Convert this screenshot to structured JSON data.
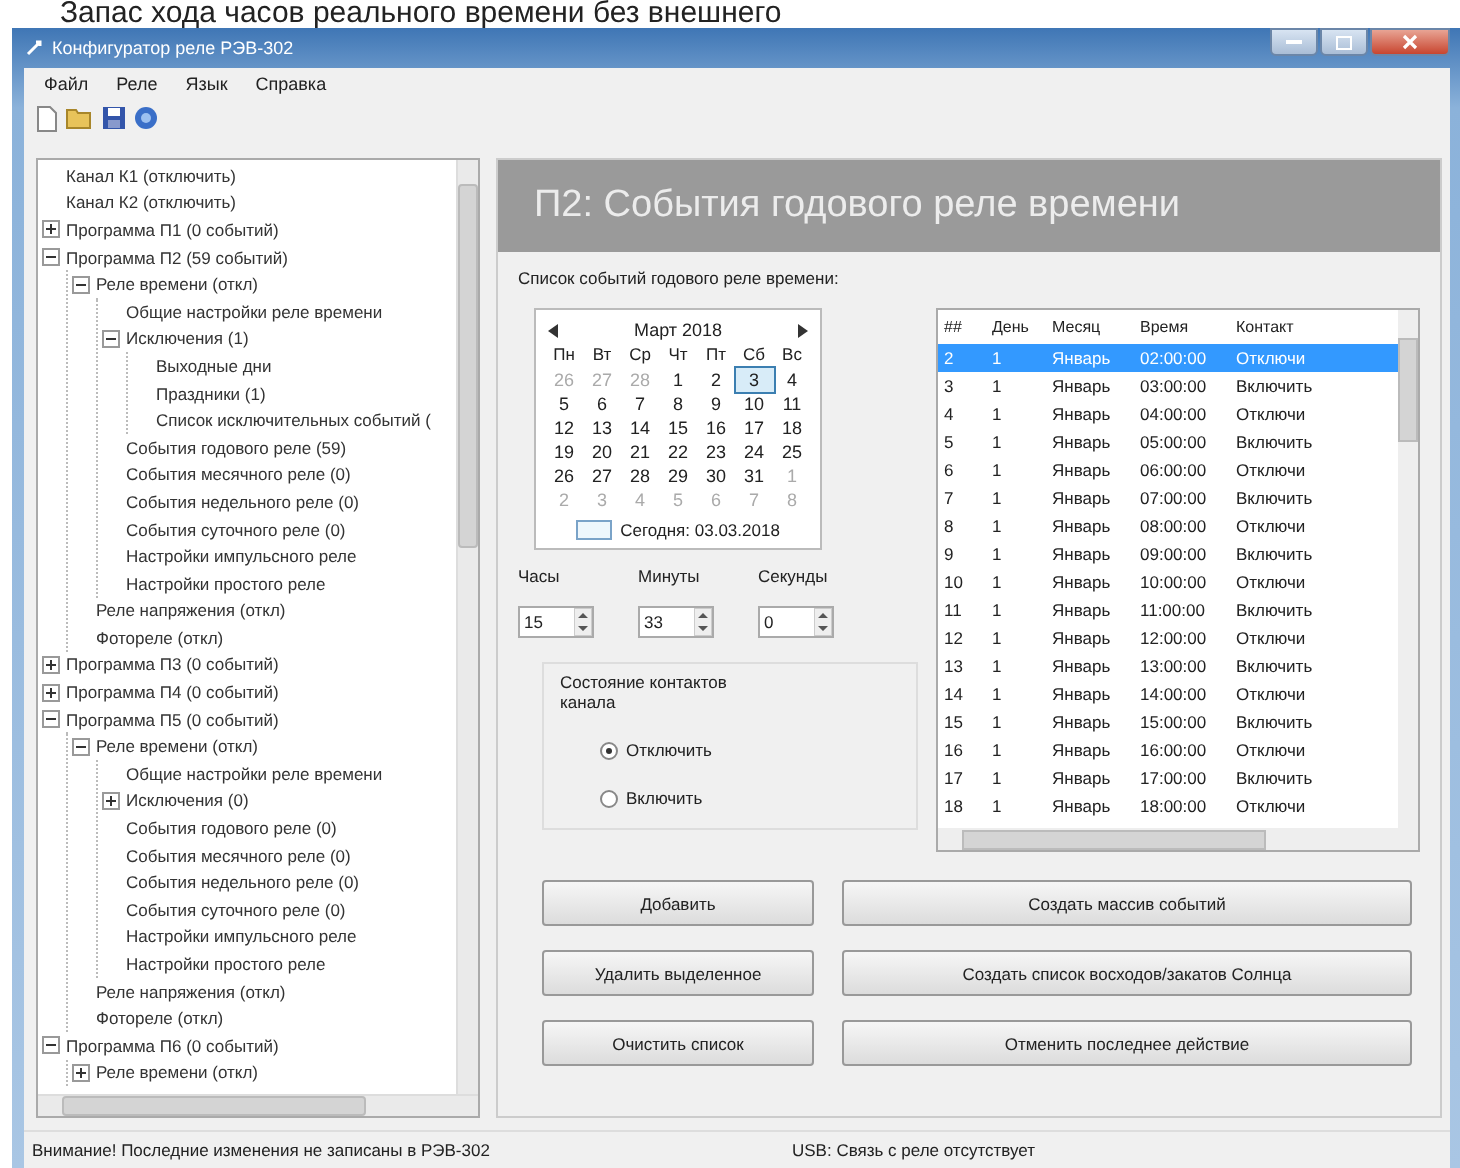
{
  "page_caption": "Запас хода часов реального времени без внешнего",
  "window": {
    "title": "Конфигуратор реле РЭВ-302"
  },
  "menu": [
    "Файл",
    "Реле",
    "Язык",
    "Справка"
  ],
  "tree": [
    {
      "label": "Канал К1 (отключить)"
    },
    {
      "label": "Канал К2 (отключить)"
    },
    {
      "label": "Программа П1 (0 событий)",
      "expanded": false
    },
    {
      "label": "Программа П2 (59 событий)",
      "expanded": true,
      "children": [
        {
          "label": "Реле времени (откл)",
          "expanded": true,
          "children": [
            {
              "label": "Общие настройки реле времени"
            },
            {
              "label": "Исключения (1)",
              "expanded": true,
              "children": [
                {
                  "label": "Выходные дни"
                },
                {
                  "label": "Праздники (1)"
                },
                {
                  "label": "Список исключительных событий ("
                }
              ]
            },
            {
              "label": "События годового реле (59)"
            },
            {
              "label": "События месячного реле (0)"
            },
            {
              "label": "События недельного реле (0)"
            },
            {
              "label": "События суточного реле (0)"
            },
            {
              "label": "Настройки импульсного реле"
            },
            {
              "label": "Настройки простого реле"
            }
          ]
        },
        {
          "label": "Реле напряжения (откл)"
        },
        {
          "label": "Фотореле (откл)"
        }
      ]
    },
    {
      "label": "Программа П3 (0 событий)",
      "expanded": false
    },
    {
      "label": "Программа П4 (0 событий)",
      "expanded": false
    },
    {
      "label": "Программа П5 (0 событий)",
      "expanded": true,
      "children": [
        {
          "label": "Реле времени (откл)",
          "expanded": true,
          "children": [
            {
              "label": "Общие настройки реле времени"
            },
            {
              "label": "Исключения (0)",
              "expanded": false
            },
            {
              "label": "События годового реле (0)"
            },
            {
              "label": "События месячного реле (0)"
            },
            {
              "label": "События недельного реле (0)"
            },
            {
              "label": "События суточного реле (0)"
            },
            {
              "label": "Настройки импульсного реле"
            },
            {
              "label": "Настройки простого реле"
            }
          ]
        },
        {
          "label": "Реле напряжения (откл)"
        },
        {
          "label": "Фотореле (откл)"
        }
      ]
    },
    {
      "label": "Программа П6 (0 событий)",
      "expanded": true,
      "children": [
        {
          "label": "Реле времени (откл)",
          "expanded": false
        }
      ]
    }
  ],
  "panel_title": "П2:  События годового реле времени",
  "list_label": "Список событий годового реле времени:",
  "calendar": {
    "month": "Март 2018",
    "weekdays": [
      "Пн",
      "Вт",
      "Ср",
      "Чт",
      "Пт",
      "Сб",
      "Вс"
    ],
    "weeks": [
      [
        {
          "day": "26",
          "muted": true,
          "selected": false
        },
        {
          "day": "27",
          "muted": true,
          "selected": false
        },
        {
          "day": "28",
          "muted": true,
          "selected": false
        },
        {
          "day": "1",
          "muted": false,
          "selected": false
        },
        {
          "day": "2",
          "muted": false,
          "selected": false
        },
        {
          "day": "3",
          "muted": false,
          "selected": true
        },
        {
          "day": "4",
          "muted": false,
          "selected": false
        }
      ],
      [
        {
          "day": "5",
          "muted": false,
          "selected": false
        },
        {
          "day": "6",
          "muted": false,
          "selected": false
        },
        {
          "day": "7",
          "muted": false,
          "selected": false
        },
        {
          "day": "8",
          "muted": false,
          "selected": false
        },
        {
          "day": "9",
          "muted": false,
          "selected": false
        },
        {
          "day": "10",
          "muted": false,
          "selected": false
        },
        {
          "day": "11",
          "muted": false,
          "selected": false
        }
      ],
      [
        {
          "day": "12",
          "muted": false,
          "selected": false
        },
        {
          "day": "13",
          "muted": false,
          "selected": false
        },
        {
          "day": "14",
          "muted": false,
          "selected": false
        },
        {
          "day": "15",
          "muted": false,
          "selected": false
        },
        {
          "day": "16",
          "muted": false,
          "selected": false
        },
        {
          "day": "17",
          "muted": false,
          "selected": false
        },
        {
          "day": "18",
          "muted": false,
          "selected": false
        }
      ],
      [
        {
          "day": "19",
          "muted": false,
          "selected": false
        },
        {
          "day": "20",
          "muted": false,
          "selected": false
        },
        {
          "day": "21",
          "muted": false,
          "selected": false
        },
        {
          "day": "22",
          "muted": false,
          "selected": false
        },
        {
          "day": "23",
          "muted": false,
          "selected": false
        },
        {
          "day": "24",
          "muted": false,
          "selected": false
        },
        {
          "day": "25",
          "muted": false,
          "selected": false
        }
      ],
      [
        {
          "day": "26",
          "muted": false,
          "selected": false
        },
        {
          "day": "27",
          "muted": false,
          "selected": false
        },
        {
          "day": "28",
          "muted": false,
          "selected": false
        },
        {
          "day": "29",
          "muted": false,
          "selected": false
        },
        {
          "day": "30",
          "muted": false,
          "selected": false
        },
        {
          "day": "31",
          "muted": false,
          "selected": false
        },
        {
          "day": "1",
          "muted": true,
          "selected": false
        }
      ],
      [
        {
          "day": "2",
          "muted": true,
          "selected": false
        },
        {
          "day": "3",
          "muted": true,
          "selected": false
        },
        {
          "day": "4",
          "muted": true,
          "selected": false
        },
        {
          "day": "5",
          "muted": true,
          "selected": false
        },
        {
          "day": "6",
          "muted": true,
          "selected": false
        },
        {
          "day": "7",
          "muted": true,
          "selected": false
        },
        {
          "day": "8",
          "muted": true,
          "selected": false
        }
      ]
    ],
    "today": "Сегодня: 03.03.2018"
  },
  "time_fields": [
    {
      "label": "Часы",
      "value": "15"
    },
    {
      "label": "Минуты",
      "value": "33"
    },
    {
      "label": "Секунды",
      "value": "0"
    }
  ],
  "contacts": {
    "title": "Состояние контактов канала",
    "options": [
      {
        "label": "Отключить",
        "selected": true
      },
      {
        "label": "Включить",
        "selected": false
      }
    ]
  },
  "table": {
    "columns": [
      "##",
      "День",
      "Месяц",
      "Время",
      "Контакт"
    ],
    "rows": [
      {
        "cells": [
          "2",
          "1",
          "Январь",
          "02:00:00",
          "Отключи"
        ],
        "selected": true
      },
      {
        "cells": [
          "3",
          "1",
          "Январь",
          "03:00:00",
          "Включить"
        ],
        "selected": false
      },
      {
        "cells": [
          "4",
          "1",
          "Январь",
          "04:00:00",
          "Отключи"
        ],
        "selected": false
      },
      {
        "cells": [
          "5",
          "1",
          "Январь",
          "05:00:00",
          "Включить"
        ],
        "selected": false
      },
      {
        "cells": [
          "6",
          "1",
          "Январь",
          "06:00:00",
          "Отключи"
        ],
        "selected": false
      },
      {
        "cells": [
          "7",
          "1",
          "Январь",
          "07:00:00",
          "Включить"
        ],
        "selected": false
      },
      {
        "cells": [
          "8",
          "1",
          "Январь",
          "08:00:00",
          "Отключи"
        ],
        "selected": false
      },
      {
        "cells": [
          "9",
          "1",
          "Январь",
          "09:00:00",
          "Включить"
        ],
        "selected": false
      },
      {
        "cells": [
          "10",
          "1",
          "Январь",
          "10:00:00",
          "Отключи"
        ],
        "selected": false
      },
      {
        "cells": [
          "11",
          "1",
          "Январь",
          "11:00:00",
          "Включить"
        ],
        "selected": false
      },
      {
        "cells": [
          "12",
          "1",
          "Январь",
          "12:00:00",
          "Отключи"
        ],
        "selected": false
      },
      {
        "cells": [
          "13",
          "1",
          "Январь",
          "13:00:00",
          "Включить"
        ],
        "selected": false
      },
      {
        "cells": [
          "14",
          "1",
          "Январь",
          "14:00:00",
          "Отключи"
        ],
        "selected": false
      },
      {
        "cells": [
          "15",
          "1",
          "Январь",
          "15:00:00",
          "Включить"
        ],
        "selected": false
      },
      {
        "cells": [
          "16",
          "1",
          "Январь",
          "16:00:00",
          "Отключи"
        ],
        "selected": false
      },
      {
        "cells": [
          "17",
          "1",
          "Январь",
          "17:00:00",
          "Включить"
        ],
        "selected": false
      },
      {
        "cells": [
          "18",
          "1",
          "Январь",
          "18:00:00",
          "Отключи"
        ],
        "selected": false
      }
    ]
  },
  "left_buttons": [
    "Добавить",
    "Удалить выделенное",
    "Очистить список"
  ],
  "right_buttons": [
    "Создать массив событий",
    "Создать список восходов/закатов Солнца",
    "Отменить последнее действие"
  ],
  "status_bar": {
    "message": "Внимание! Последние изменения не записаны в РЭВ-302",
    "connection": "USB: Связь с реле отсутствует"
  }
}
